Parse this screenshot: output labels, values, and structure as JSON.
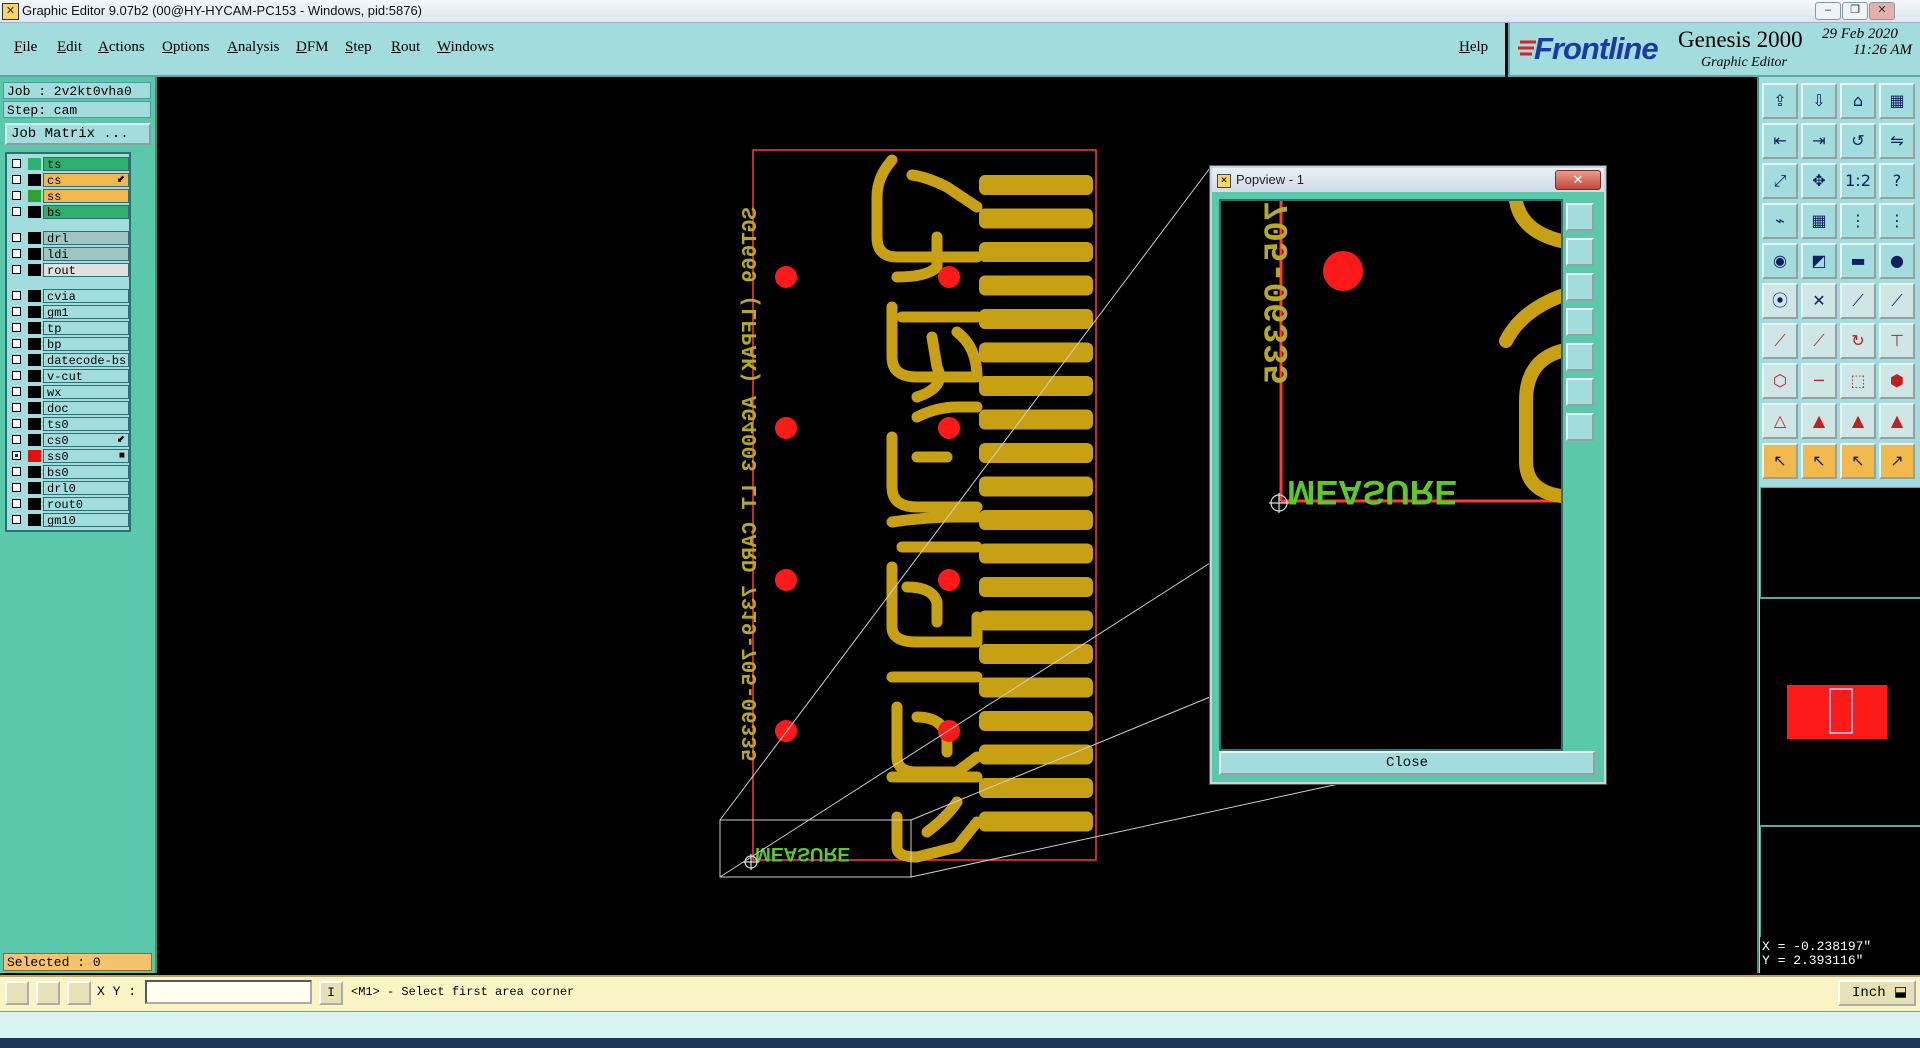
{
  "window": {
    "title": "Graphic Editor 9.07b2 (00@HY-HYCAM-PC153 - Windows, pid:5876)",
    "minimize": "–",
    "maximize": "❐",
    "close": "✕"
  },
  "menu": {
    "items": [
      "File",
      "Edit",
      "Actions",
      "Options",
      "Analysis",
      "DFM",
      "Step",
      "Rout",
      "Windows"
    ],
    "help": "Help"
  },
  "brand": {
    "logo": "Frontline",
    "product": "Genesis 2000",
    "subtitle": "Graphic Editor",
    "date": "29 Feb 2020",
    "time": "11:26 AM"
  },
  "left": {
    "job": "Job : 2v2kt0vha0",
    "step": "Step: cam",
    "job_matrix": "Job Matrix ...",
    "layers": [
      {
        "name": "ts",
        "color": "#2fb06f",
        "bg": "#2fb06f",
        "mark": ""
      },
      {
        "name": "cs",
        "color": "#000000",
        "bg": "#f2b74e",
        "mark": "⬋"
      },
      {
        "name": "ss",
        "color": "#2fa12f",
        "bg": "#f2b74e",
        "mark": ""
      },
      {
        "name": "bs",
        "color": "#000000",
        "bg": "#2fb06f",
        "mark": ""
      },
      {
        "name": "drl",
        "color": "#000000",
        "bg": "#9ec4c4",
        "mark": ""
      },
      {
        "name": "ldi",
        "color": "#000000",
        "bg": "#9ec4c4",
        "mark": ""
      },
      {
        "name": "rout",
        "color": "#000000",
        "bg": "#e0e0e0",
        "mark": ""
      },
      {
        "name": "cvia",
        "color": "#000000",
        "bg": "#a3dcdc",
        "mark": ""
      },
      {
        "name": "gm1",
        "color": "#000000",
        "bg": "#a3dcdc",
        "mark": ""
      },
      {
        "name": "tp",
        "color": "#000000",
        "bg": "#a3dcdc",
        "mark": ""
      },
      {
        "name": "bp",
        "color": "#000000",
        "bg": "#a3dcdc",
        "mark": ""
      },
      {
        "name": "datecode-bs",
        "color": "#000000",
        "bg": "#a3dcdc",
        "mark": ""
      },
      {
        "name": "v-cut",
        "color": "#000000",
        "bg": "#a3dcdc",
        "mark": ""
      },
      {
        "name": "wx",
        "color": "#000000",
        "bg": "#a3dcdc",
        "mark": ""
      },
      {
        "name": "doc",
        "color": "#000000",
        "bg": "#a3dcdc",
        "mark": ""
      },
      {
        "name": "ts0",
        "color": "#000000",
        "bg": "#a3dcdc",
        "mark": ""
      },
      {
        "name": "cs0",
        "color": "#000000",
        "bg": "#a3dcdc",
        "mark": "⬋"
      },
      {
        "name": "ss0",
        "color": "#e01010",
        "bg": "#a3dcdc",
        "mark": "■"
      },
      {
        "name": "bs0",
        "color": "#000000",
        "bg": "#a3dcdc",
        "mark": ""
      },
      {
        "name": "drl0",
        "color": "#000000",
        "bg": "#a3dcdc",
        "mark": ""
      },
      {
        "name": "rout0",
        "color": "#000000",
        "bg": "#a3dcdc",
        "mark": ""
      },
      {
        "name": "gm10",
        "color": "#000000",
        "bg": "#a3dcdc",
        "mark": ""
      }
    ],
    "selected": "Selected : 0"
  },
  "canvas": {
    "silk_text": "SGT669 (LFPAK) AG4003 LT CARD 7319-705-06335",
    "measure_label": "MEASURE",
    "colors": {
      "copper": "#c8a014",
      "pad": "#ff1a1a",
      "outline": "#ff3a3a",
      "silk": "#b8a828",
      "measure": "#5cc82a"
    }
  },
  "popview": {
    "title": "Popview - 1",
    "close_x": "✕",
    "close_label": "Close",
    "silk_text": "705-06335",
    "measure_label": "MEASURE"
  },
  "status": {
    "xy_label": "X Y :",
    "xy_value": "",
    "info": "I",
    "prompt": "<M1> - Select first area corner",
    "units": "Inch"
  },
  "coords": {
    "x": "X = -0.238197\"",
    "y": "Y = 2.393116\""
  }
}
